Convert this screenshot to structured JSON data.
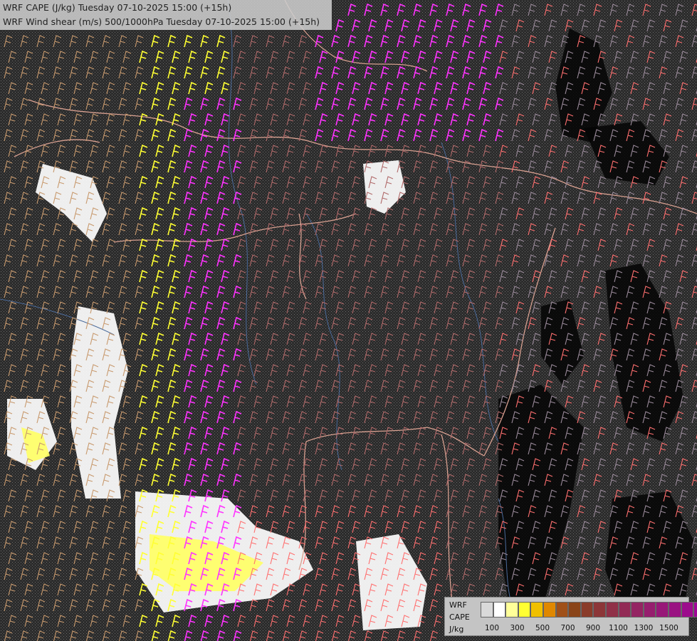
{
  "title": {
    "line1": "WRF CAPE (J/kg) Tuesday 07-10-2025 15:00 (+15h)",
    "line2": "WRF Wind shear (m/s) 500/1000hPa Tuesday 07-10-2025 15:00 (+15h)"
  },
  "legend": {
    "label_model": "WRF",
    "label_field": "CAPE",
    "label_unit": "J/kg",
    "swatch_colors": [
      "#d9d9d9",
      "#ffffff",
      "#ffff99",
      "#ffff33",
      "#f0c000",
      "#e08800",
      "#a05018",
      "#8a4418",
      "#8a3c2a",
      "#8c3638",
      "#903048",
      "#922a55",
      "#942462",
      "#961e6e",
      "#981878",
      "#9a1282",
      "#9c0c8c",
      "#9e0696",
      "#a000a0"
    ],
    "tick_labels": [
      "100",
      "300",
      "500",
      "700",
      "900",
      "1100",
      "1300",
      "1500"
    ]
  },
  "colors": {
    "shear_weak": "#c89a6e",
    "shear_moderate": "#ffff33",
    "shear_strong": "#ff33ff",
    "shear_pink": "#ff7070",
    "shear_dim": "#b06a6a",
    "borders": "#d8a090",
    "rivers": "#4a6a9a",
    "cape_high": "#ffff66",
    "cape_low": "#ffffff"
  }
}
